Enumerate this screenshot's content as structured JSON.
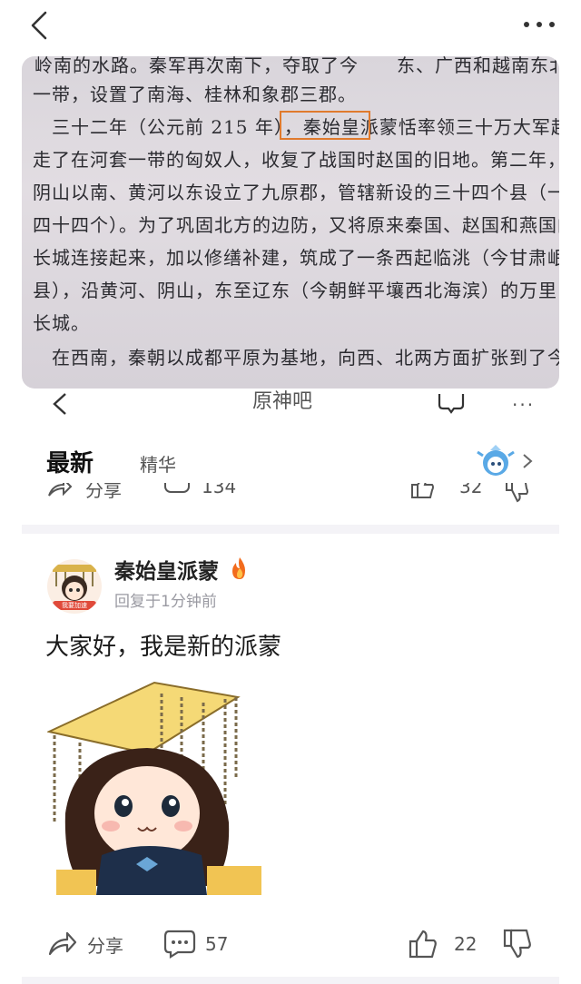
{
  "book_lines": [
    "岭南的水路。秦军再次南下，夺取了今　　东、广西和越南东北",
    "一带，设置了南海、桂林和象郡三郡。",
    "　三十二年（公元前 215 年），秦始皇派蒙恬率领三十万大军赶",
    "走了在河套一带的匈奴人，收复了战国时赵国的旧地。第二年，在",
    "阴山以南、黄河以东设立了九原郡，管辖新设的三十四个县（一说",
    "四十四个）。为了巩固北方的边防，又将原来秦国、赵国和燕国的",
    "长城连接起来，加以修缮补建，筑成了一条西起临洮（今甘肃岷",
    "县），沿黄河、阴山，东至辽东（今朝鲜平壤西北海滨）的万里",
    "长城。",
    "　在西南，秦朝以成都平原为基地，向西、北两方面扩张到了今"
  ],
  "forum": {
    "title": "原神吧",
    "tabs": {
      "latest": "最新",
      "best": "精华"
    }
  },
  "ghost_actions": {
    "share": "分享",
    "comments": "134",
    "likes": "32"
  },
  "post": {
    "username": "秦始皇派蒙",
    "reply_time": "回复于1分钟前",
    "text": "大家好，我是新的派蒙",
    "avatar_badge": "我要加速",
    "share_label": "分享",
    "comment_count": "57",
    "like_count": "22"
  },
  "colors": {
    "highlight_box": "#e07a2d",
    "fire": "#f26b1d",
    "page_bg": "#ffffff",
    "divider": "#f4f3f7"
  }
}
